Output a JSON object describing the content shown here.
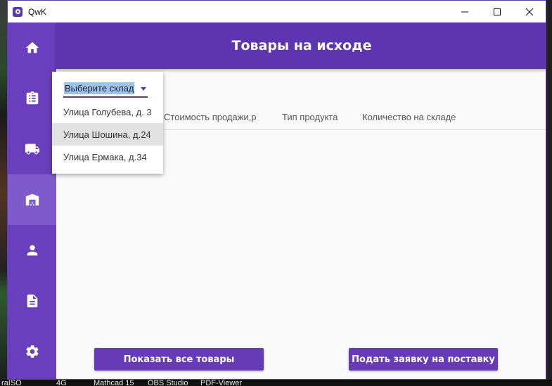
{
  "window": {
    "app_title": "QwK"
  },
  "header": {
    "title": "Товары на исходе"
  },
  "sidebar": {
    "items": [
      {
        "name": "home",
        "icon": "home-icon"
      },
      {
        "name": "clipboard",
        "icon": "clipboard-list-icon"
      },
      {
        "name": "delivery",
        "icon": "truck-icon"
      },
      {
        "name": "warehouse",
        "icon": "warehouse-icon",
        "active": true
      },
      {
        "name": "user",
        "icon": "person-icon"
      },
      {
        "name": "document",
        "icon": "document-icon"
      },
      {
        "name": "settings",
        "icon": "gear-icon"
      }
    ]
  },
  "table": {
    "columns": [
      "Стоимость продажи,р",
      "Тип продукта",
      "Количество на складе"
    ]
  },
  "warehouse_select": {
    "value": "Выберите склад",
    "options": [
      "Улица Голубева, д. 3",
      "Улица Шошина, д.24",
      "Улица Ермака, д.34"
    ],
    "highlighted_index": 1
  },
  "buttons": {
    "show_all": "Показать все товары",
    "submit_request": "Подать заявку на поставку"
  },
  "desktop": {
    "taskbar_labels": [
      "raISO",
      "4G",
      "Mathcad 15",
      "OBS Studio",
      "PDF-Viewer"
    ]
  },
  "colors": {
    "primary": "#5e35b1",
    "sidebar": "#6a3fbd",
    "sidebar_active": "#7e5acb",
    "button": "#673ab7"
  }
}
